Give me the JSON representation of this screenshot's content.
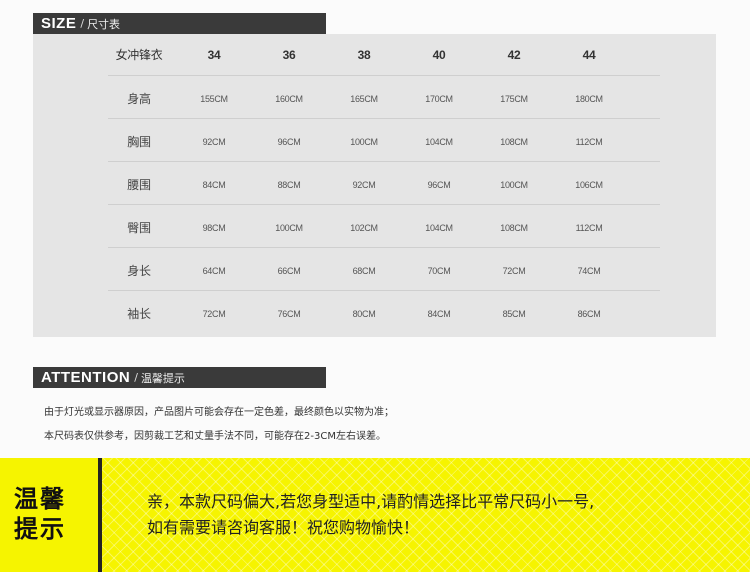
{
  "size_section": {
    "title": "SIZE",
    "separator": "/",
    "subtitle": "尺寸表"
  },
  "table": {
    "header_label": "女冲锋衣",
    "sizes": [
      "34",
      "36",
      "38",
      "40",
      "42",
      "44"
    ],
    "rows": [
      {
        "label": "身高",
        "values": [
          "155CM",
          "160CM",
          "165CM",
          "170CM",
          "175CM",
          "180CM"
        ]
      },
      {
        "label": "胸围",
        "values": [
          "92CM",
          "96CM",
          "100CM",
          "104CM",
          "108CM",
          "112CM"
        ]
      },
      {
        "label": "腰围",
        "values": [
          "84CM",
          "88CM",
          "92CM",
          "96CM",
          "100CM",
          "106CM"
        ]
      },
      {
        "label": "臀围",
        "values": [
          "98CM",
          "100CM",
          "102CM",
          "104CM",
          "108CM",
          "112CM"
        ]
      },
      {
        "label": "身长",
        "values": [
          "64CM",
          "66CM",
          "68CM",
          "70CM",
          "72CM",
          "74CM"
        ]
      },
      {
        "label": "袖长",
        "values": [
          "72CM",
          "76CM",
          "80CM",
          "84CM",
          "85CM",
          "86CM"
        ]
      }
    ]
  },
  "attention_section": {
    "title": "ATTENTION",
    "separator": "/",
    "subtitle": "温馨提示"
  },
  "notices": [
    "由于灯光或显示器原因，产品图片可能会存在一定色差，最终颜色以实物为准；",
    "本尺码表仅供参考，因剪裁工艺和丈量手法不同，可能存在2-3CM左右误差。"
  ],
  "banner": {
    "title_line_1": "温馨",
    "title_line_2": "提示",
    "line_1": "亲，本款尺码偏大,若您身型适中,请酌情选择比平常尺码小一号,",
    "line_2": "如有需要请咨询客服！祝您购物愉快！"
  },
  "colors": {
    "banner_yellow": "#f6f400",
    "bar_dark": "#3a3a3a",
    "table_bg": "#e5e5e5"
  }
}
